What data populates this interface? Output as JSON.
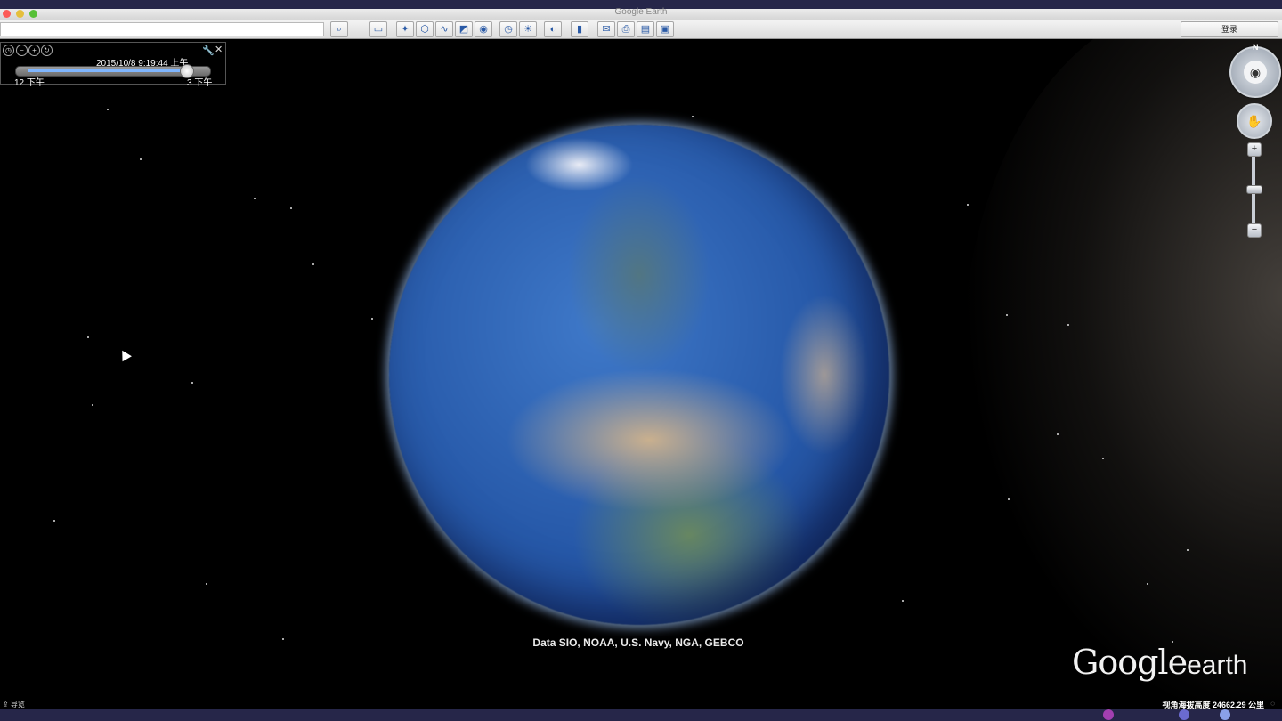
{
  "window": {
    "title": "Google Earth"
  },
  "toolbar": {
    "search_value": "",
    "login_label": "登录",
    "icons": [
      "search-icon",
      "sidebar-icon",
      "placemark-icon",
      "polygon-icon",
      "path-icon",
      "overlay-icon",
      "tour-icon",
      "historical-imagery-icon",
      "sun-icon",
      "planet-icon",
      "ruler-icon",
      "email-icon",
      "print-icon",
      "maps-icon",
      "save-image-icon"
    ]
  },
  "time_slider": {
    "datetime": "2015/10/8   9:19:44 上午",
    "start_label": "12 下午",
    "end_label": "3 下午",
    "position_fraction": 0.9
  },
  "viewport": {
    "attribution": "Data SIO, NOAA, U.S. Navy, NGA, GEBCO",
    "logo_google": "Google",
    "logo_earth": "earth"
  },
  "navigation": {
    "north_label": "N",
    "zoom_in": "+",
    "zoom_out": "−"
  },
  "status": {
    "left": "⇪ 导览",
    "eye_alt": "视角海拔高度 24662.29 公里"
  },
  "colors": {
    "desktop": "#262649",
    "space": "#000000",
    "ocean": "#2658a8"
  }
}
